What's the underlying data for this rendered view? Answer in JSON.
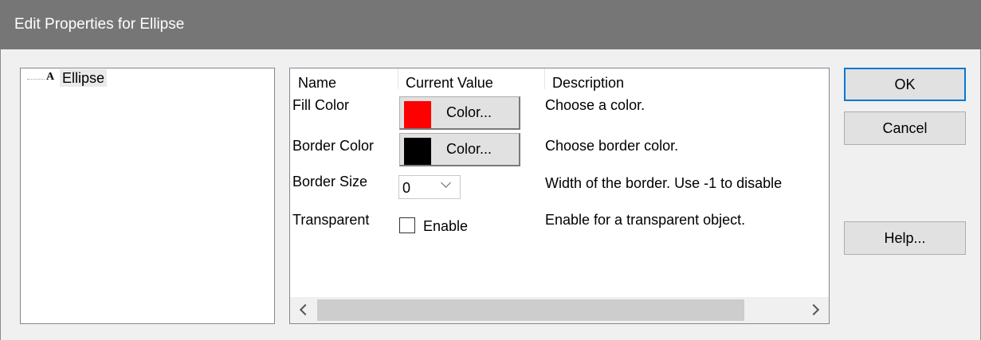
{
  "window": {
    "title": "Edit Properties for Ellipse"
  },
  "tree": {
    "items": [
      {
        "glyph": "A",
        "label": "Ellipse"
      }
    ]
  },
  "grid": {
    "columns": [
      "Name",
      "Current Value",
      "Description"
    ],
    "rows": [
      {
        "name": "Fill Color",
        "value_label": "Color...",
        "swatch": "#ff0000",
        "description": "Choose a color."
      },
      {
        "name": "Border Color",
        "value_label": "Color...",
        "swatch": "#000000",
        "description": "Choose border color."
      },
      {
        "name": "Border Size",
        "value": "0",
        "description": "Width of the border. Use -1 to disable"
      },
      {
        "name": "Transparent",
        "checkbox_label": "Enable",
        "checked": false,
        "description": "Enable for a transparent object."
      }
    ]
  },
  "buttons": {
    "ok": "OK",
    "cancel": "Cancel",
    "help": "Help..."
  },
  "colors": {
    "titlebar": "#767676",
    "accent": "#0078d7",
    "background": "#f0f0f0"
  }
}
